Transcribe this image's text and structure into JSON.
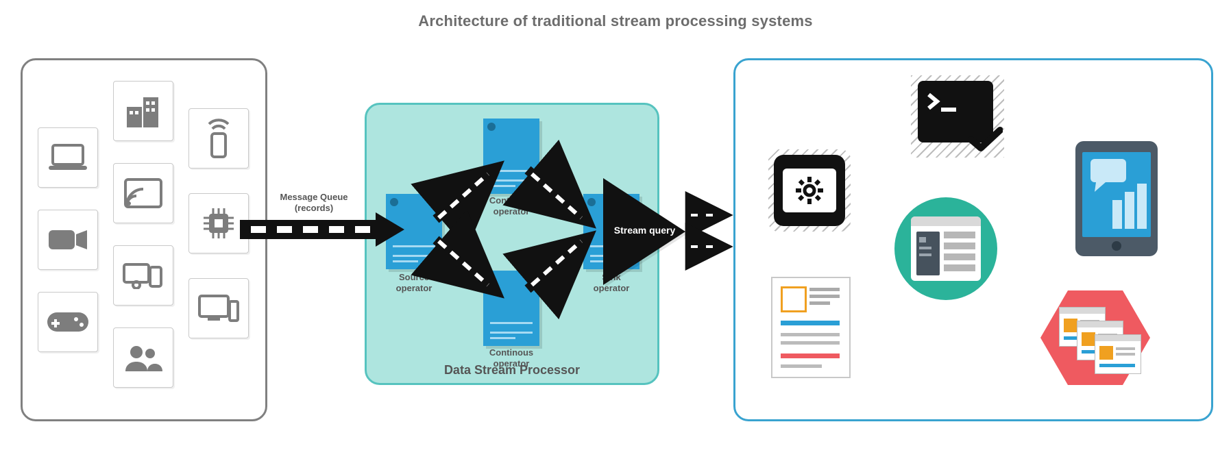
{
  "title": "Architecture of traditional stream processing systems",
  "flow": {
    "mq_label": "Message Queue\n(records)",
    "query_label": "Stream query"
  },
  "processor": {
    "panel_label": "Data Stream Processor",
    "source_label": "Source\noperator",
    "top_label": "Continous\noperator",
    "bottom_label": "Continous\noperator",
    "sink_label": "Sink\noperator"
  },
  "sources": [
    {
      "name": "laptop-icon"
    },
    {
      "name": "camera-icon"
    },
    {
      "name": "gamepad-icon"
    },
    {
      "name": "building-icon"
    },
    {
      "name": "cast-icon"
    },
    {
      "name": "devices-icon"
    },
    {
      "name": "users-icon"
    },
    {
      "name": "iot-icon"
    },
    {
      "name": "chip-icon"
    },
    {
      "name": "desktop-icon"
    }
  ],
  "sinks": [
    {
      "name": "settings-app-icon"
    },
    {
      "name": "document-icon"
    },
    {
      "name": "terminal-check-icon"
    },
    {
      "name": "browser-app-icon"
    },
    {
      "name": "mobile-chat-icon"
    },
    {
      "name": "cascading-windows-icon"
    }
  ]
}
